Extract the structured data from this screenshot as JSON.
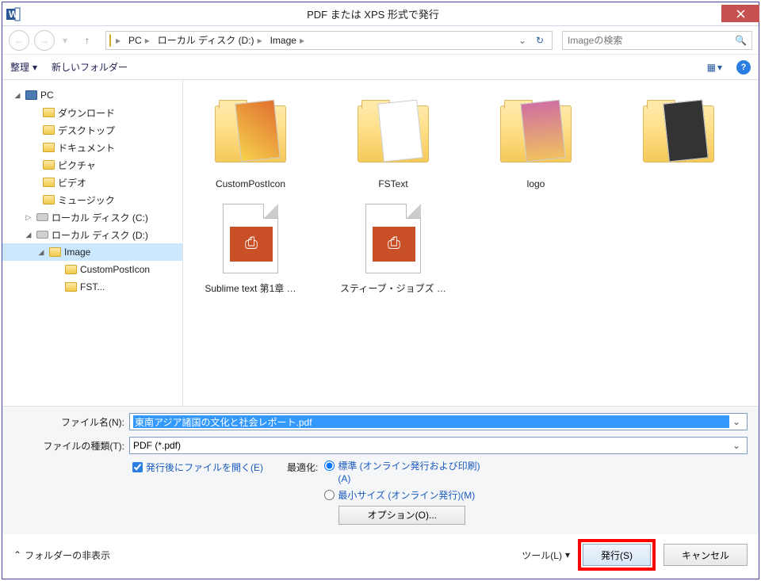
{
  "title": "PDF または XPS 形式で発行",
  "breadcrumb": {
    "pc": "PC",
    "d": "ローカル ディスク (D:)",
    "img": "Image"
  },
  "search": {
    "placeholder": "Imageの検索"
  },
  "bar2": {
    "organize": "整理",
    "newfolder": "新しいフォルダー"
  },
  "tree": {
    "pc": "PC",
    "downloads": "ダウンロード",
    "desktop": "デスクトップ",
    "documents": "ドキュメント",
    "pictures": "ピクチャ",
    "videos": "ビデオ",
    "music": "ミュージック",
    "cdrive": "ローカル ディスク (C:)",
    "ddrive": "ローカル ディスク (D:)",
    "image": "Image",
    "custompost": "CustomPostIcon",
    "fst": "FST..."
  },
  "files": {
    "f1": "CustomPostIcon",
    "f2": "FSText",
    "f3": "logo",
    "f4": "",
    "f5": "Sublime text 第1章 …",
    "f6": "スティーブ・ジョブズ …"
  },
  "labels": {
    "filename": "ファイル名(N):",
    "filetype": "ファイルの種類(T):"
  },
  "filename": "東南アジア諸国の文化と社会レポート.pdf",
  "filetype": "PDF (*.pdf)",
  "openafter": "発行後にファイルを開く(E)",
  "optimize": {
    "label": "最適化:",
    "standard": "標準 (オンライン発行および印刷)(A)",
    "min": "最小サイズ (オンライン発行)(M)"
  },
  "options": "オプション(O)...",
  "hidefolders": "フォルダーの非表示",
  "tools": "ツール(L)",
  "publish": "発行(S)",
  "cancel": "キャンセル"
}
